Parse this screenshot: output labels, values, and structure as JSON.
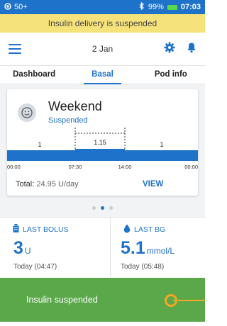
{
  "status_bar": {
    "left_text": "50+",
    "battery_pct": "99%",
    "time": "07:03",
    "icons": [
      "record-icon",
      "bluetooth-icon",
      "battery-icon"
    ]
  },
  "banner": {
    "text": "Insulin delivery is suspended"
  },
  "header": {
    "date": "2 Jan",
    "icons": [
      "menu-icon",
      "settings-icon",
      "bell-icon"
    ]
  },
  "tabs": [
    {
      "label": "Dashboard",
      "active": false
    },
    {
      "label": "Basal",
      "active": true
    },
    {
      "label": "Pod info",
      "active": false
    }
  ],
  "program_card": {
    "name": "Weekend",
    "status": "Suspended",
    "rates": [
      "1",
      "1.15",
      "1"
    ],
    "times": [
      "00:00",
      "07:30",
      "14:00",
      "00:00"
    ],
    "total_label": "Total:",
    "total_value": "24.95 U/day",
    "view_label": "VIEW"
  },
  "pager": {
    "count": 3,
    "active": 1
  },
  "last_bolus": {
    "label": "LAST BOLUS",
    "value": "3",
    "unit": "U",
    "time": "Today (04:47)"
  },
  "last_bg": {
    "label": "LAST BG",
    "value": "5.1",
    "unit": "mmol/L",
    "time": "Today (05:48)"
  },
  "suspend_bar": {
    "label": "Insulin suspended"
  },
  "colors": {
    "primary": "#1f72c9",
    "banner": "#f6e27a",
    "suspend_green": "#5aa84a",
    "slider_orange": "#f5a623"
  }
}
